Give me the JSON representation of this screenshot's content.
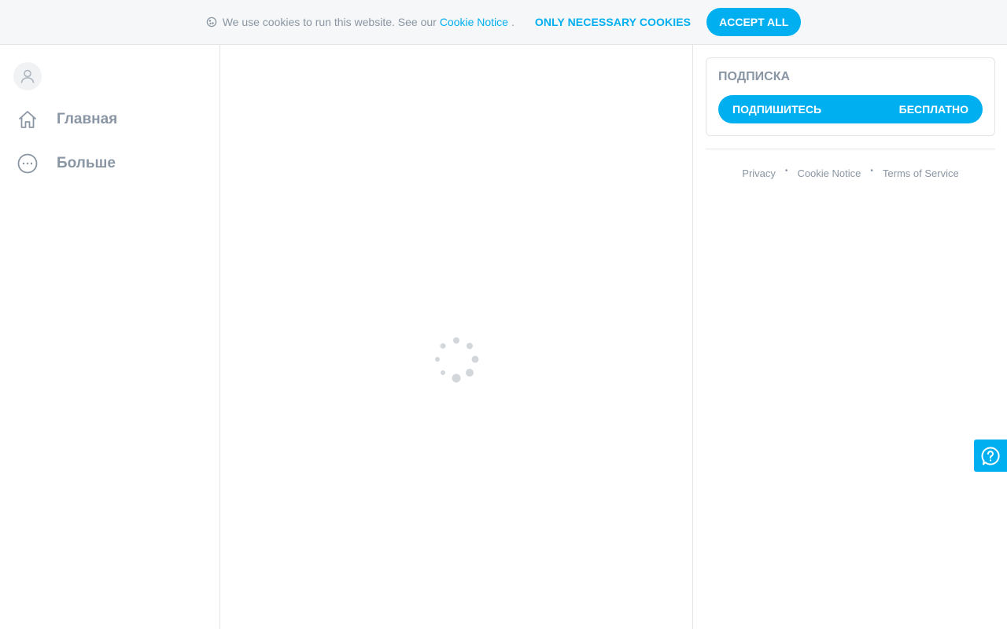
{
  "cookie_bar": {
    "message": "We use cookies to run this website. See our",
    "notice_link": "Cookie Notice",
    "trailing": ".",
    "necessary_button": "ONLY NECESSARY COOKIES",
    "accept_button": "ACCEPT ALL",
    "icon": "cookie-icon"
  },
  "sidebar": {
    "avatar_icon": "user-icon",
    "items": [
      {
        "label": "Главная",
        "icon": "home-icon"
      },
      {
        "label": "Больше",
        "icon": "more-icon"
      }
    ]
  },
  "main": {
    "loading_icon": "spinner-icon"
  },
  "subscription": {
    "title": "ПОДПИСКА",
    "button_label": "ПОДПИШИТЕСЬ",
    "button_price": "БЕСПЛАТНО"
  },
  "footer": {
    "links": [
      "Privacy",
      "Cookie Notice",
      "Terms of Service"
    ],
    "separator": "•"
  },
  "help": {
    "icon": "help-icon"
  },
  "colors": {
    "accent": "#00aff0",
    "text_muted": "#8a96a3",
    "border": "#e1e5e8",
    "bar_bg": "#f5f7f8"
  }
}
